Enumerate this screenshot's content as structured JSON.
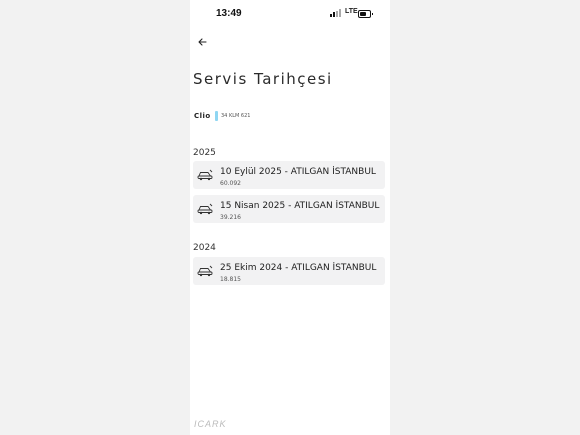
{
  "image_id": "#1316630350",
  "status_bar": {
    "time": "13:49",
    "network": "LTE"
  },
  "header": {
    "back_icon": "arrow-left-icon",
    "title": "Servis Tarihçesi"
  },
  "vehicle": {
    "name": "Clio",
    "plate": "34 KLM 621",
    "tag_color": "#8fd6f2"
  },
  "history": [
    {
      "year": "2025",
      "entries": [
        {
          "title": "10 Eylül 2025 - ATILGAN İSTANBUL",
          "km": "60.092"
        },
        {
          "title": "15 Nisan 2025 - ATILGAN İSTANBUL",
          "km": "39.216"
        }
      ]
    },
    {
      "year": "2024",
      "entries": [
        {
          "title": "25 Ekim 2024 - ATILGAN İSTANBUL",
          "km": "18.815"
        }
      ]
    }
  ],
  "footer": {
    "logo_text": "ICARK"
  },
  "colors": {
    "card_bg": "#f2f2f3",
    "accent": "#8fd6f2"
  }
}
